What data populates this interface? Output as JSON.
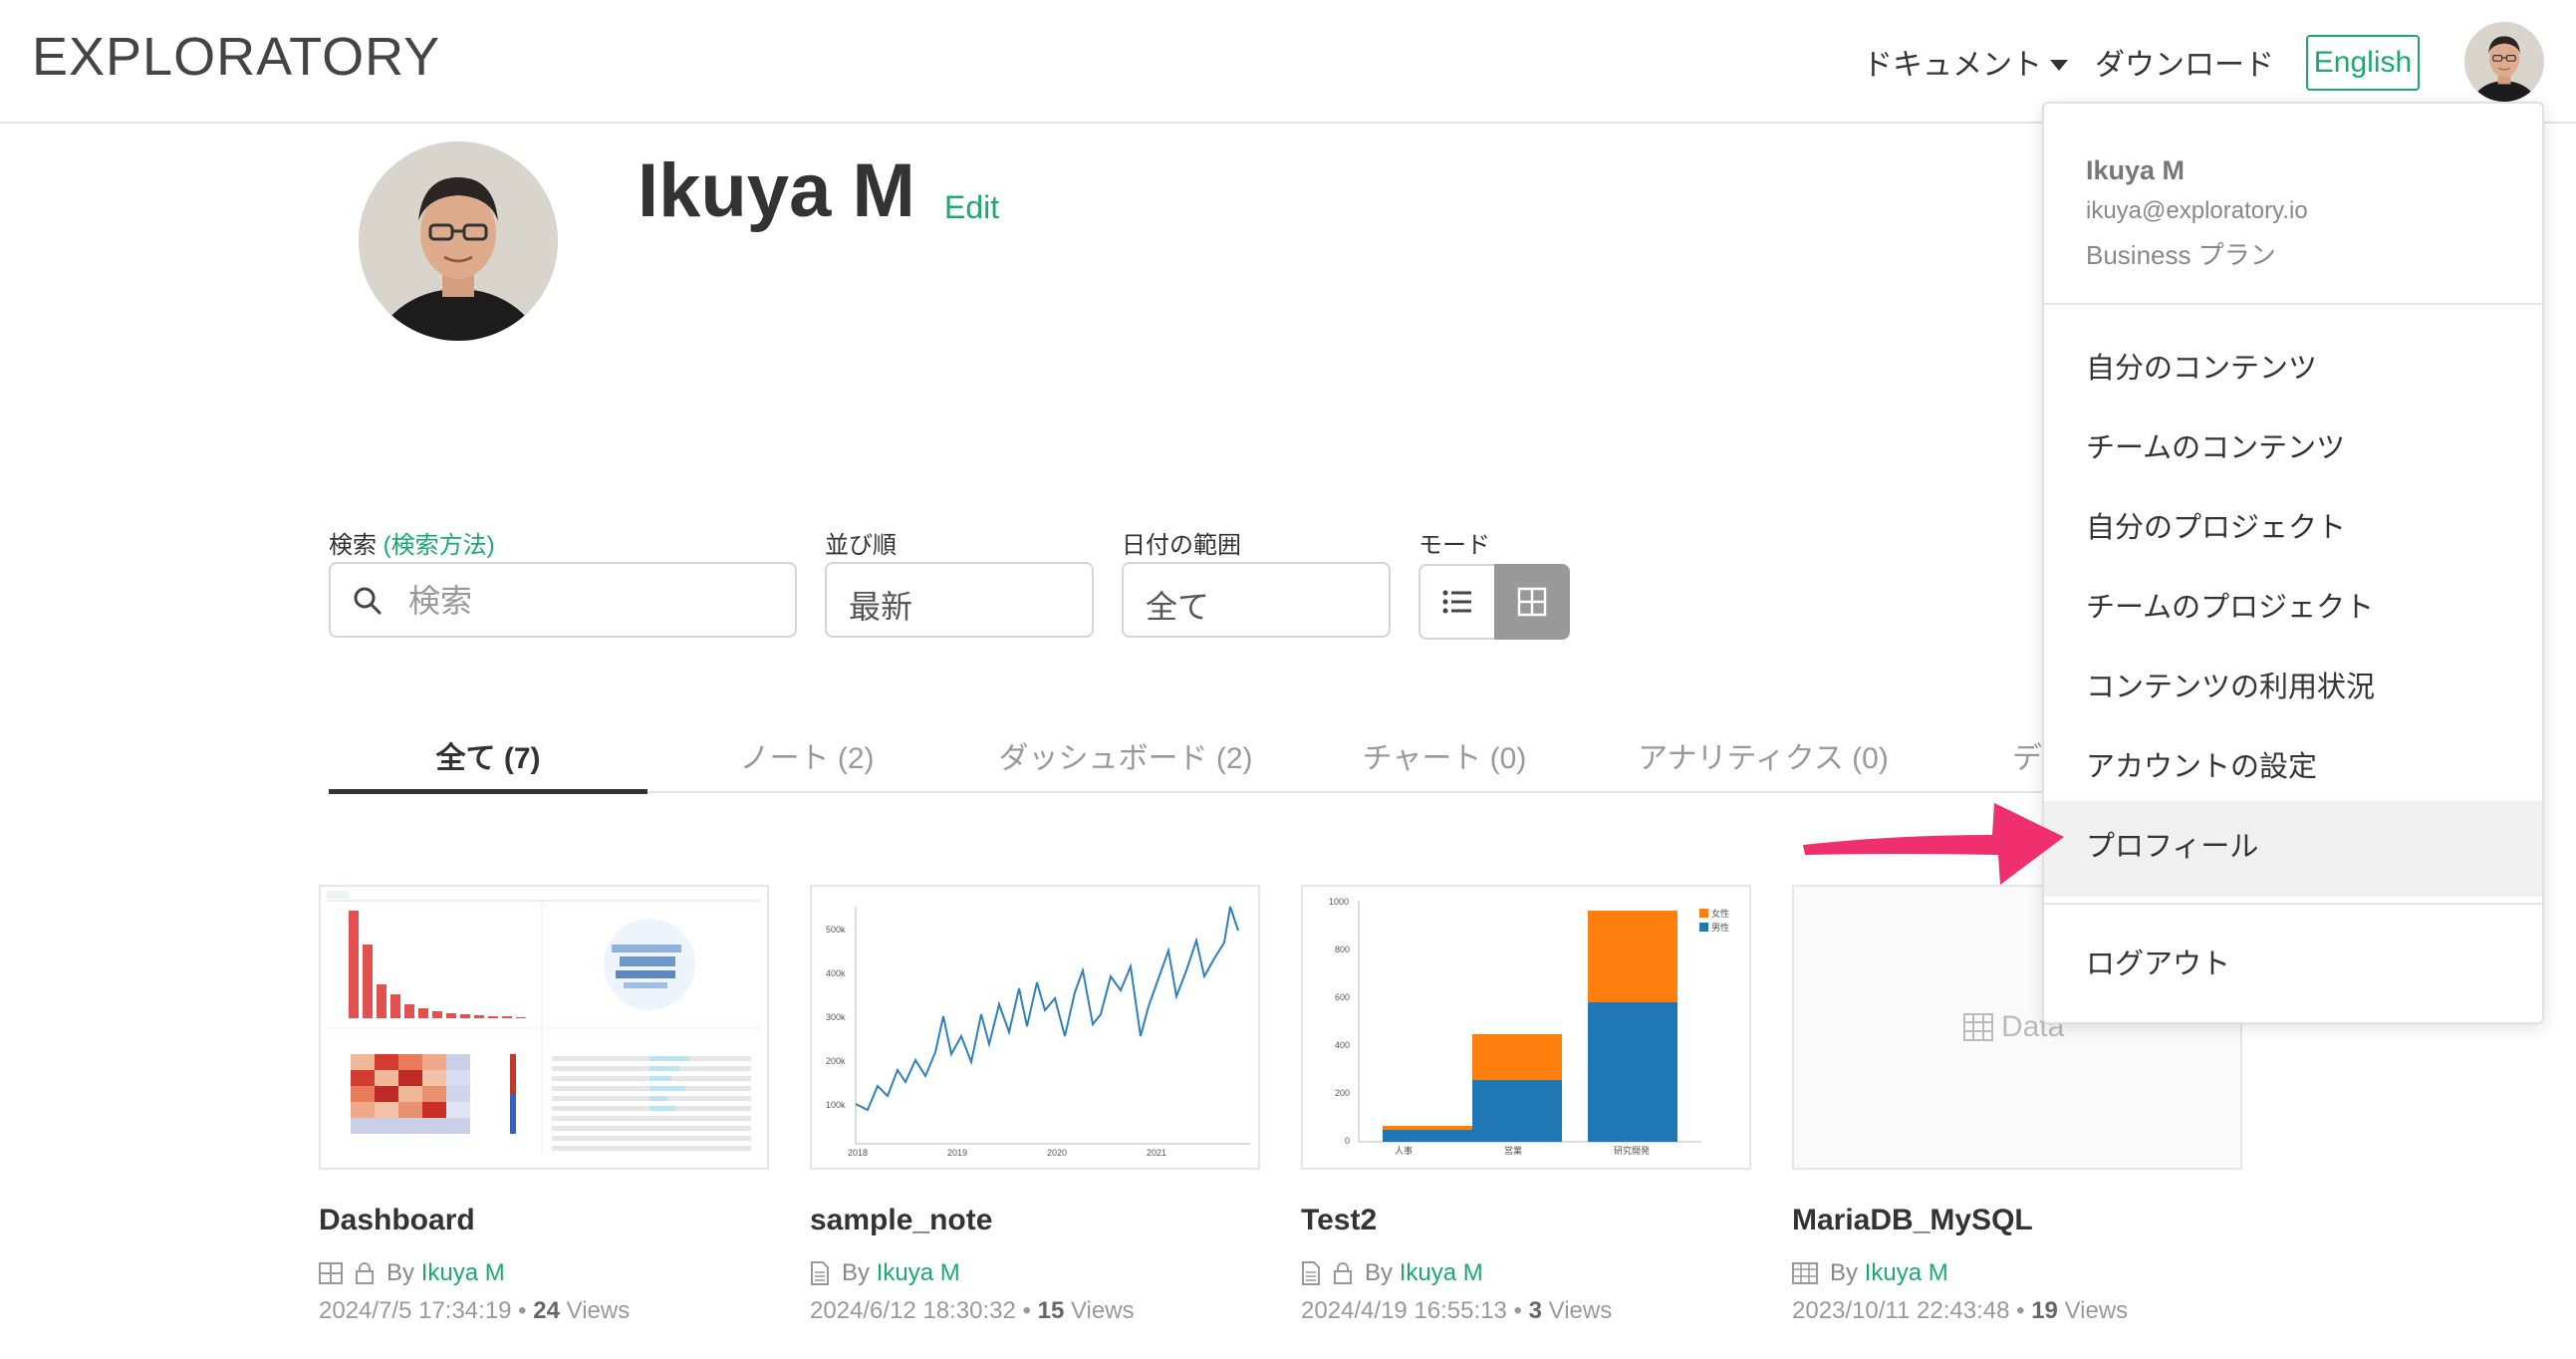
{
  "header": {
    "logo": "EXPLORATORY",
    "nav_docs": "ドキュメント",
    "nav_download": "ダウンロード",
    "lang_button": "English"
  },
  "profile": {
    "name": "Ikuya M",
    "edit": "Edit"
  },
  "filters": {
    "search_label": "検索",
    "search_help": "(検索方法)",
    "search_placeholder": "検索",
    "sort_label": "並び順",
    "sort_value": "最新",
    "date_label": "日付の範囲",
    "date_value": "全て",
    "mode_label": "モード"
  },
  "tabs": [
    {
      "label": "全て (7)"
    },
    {
      "label": "ノート (2)"
    },
    {
      "label": "ダッシュボード (2)"
    },
    {
      "label": "チャート (0)"
    },
    {
      "label": "アナリティクス (0)"
    },
    {
      "label": "デ"
    }
  ],
  "cards": [
    {
      "title": "Dashboard",
      "by": "By",
      "author": "Ikuya M",
      "date": "2024/7/5 17:34:19",
      "views": "24",
      "views_label": "Views"
    },
    {
      "title": "sample_note",
      "by": "By",
      "author": "Ikuya M",
      "date": "2024/6/12 18:30:32",
      "views": "15",
      "views_label": "Views"
    },
    {
      "title": "Test2",
      "by": "By",
      "author": "Ikuya M",
      "date": "2024/4/19 16:55:13",
      "views": "3",
      "views_label": "Views"
    },
    {
      "title": "MariaDB_MySQL",
      "by": "By",
      "author": "Ikuya M",
      "date": "2023/10/11 22:43:48",
      "views": "19",
      "views_label": "Views",
      "thumb_label": "Data"
    }
  ],
  "thumb_charts": {
    "line": {
      "yticks": [
        "500k",
        "400k",
        "300k",
        "200k",
        "100k"
      ],
      "xticks": [
        "2018",
        "2019",
        "2020",
        "2021"
      ]
    },
    "bar": {
      "yticks": [
        "1000",
        "800",
        "600",
        "400",
        "200",
        "0"
      ],
      "categories": [
        "人事",
        "営業",
        "研究開発"
      ],
      "legend": [
        "女性",
        "男性"
      ]
    }
  },
  "menu": {
    "user_name": "Ikuya M",
    "email": "ikuya@exploratory.io",
    "plan": "Business プラン",
    "items": [
      "自分のコンテンツ",
      "チームのコンテンツ",
      "自分のプロジェクト",
      "チームのプロジェクト",
      "コンテンツの利用状況",
      "アカウントの設定",
      "プロフィール"
    ],
    "logout": "ログアウト"
  },
  "colors": {
    "accent": "#1aaa6e",
    "arrow": "#f0306e",
    "bar_orange": "#ff7f0e",
    "bar_blue": "#1f77b4"
  }
}
